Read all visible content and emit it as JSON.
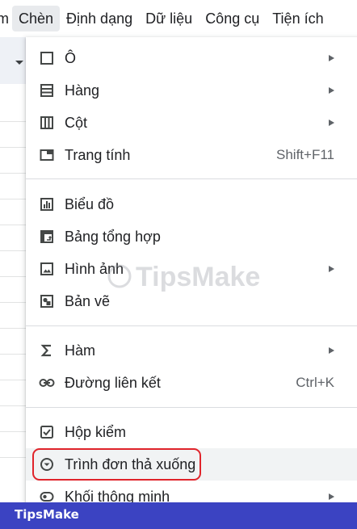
{
  "menubar": {
    "items": [
      {
        "label": "m"
      },
      {
        "label": "Chèn"
      },
      {
        "label": "Định dạng"
      },
      {
        "label": "Dữ liệu"
      },
      {
        "label": "Công cụ"
      },
      {
        "label": "Tiện ích"
      }
    ]
  },
  "menu": {
    "items": [
      {
        "label": "Ô",
        "icon": "square-icon"
      },
      {
        "label": "Hàng",
        "icon": "rows-icon"
      },
      {
        "label": "Cột",
        "icon": "columns-icon"
      },
      {
        "label": "Trang tính",
        "icon": "sheet-tab-icon",
        "shortcut": "Shift+F11"
      },
      {
        "label": "Biểu đồ",
        "icon": "chart-icon"
      },
      {
        "label": "Bảng tổng hợp",
        "icon": "pivot-table-icon"
      },
      {
        "label": "Hình ảnh",
        "icon": "image-icon"
      },
      {
        "label": "Bản vẽ",
        "icon": "drawing-icon"
      },
      {
        "label": "Hàm",
        "icon": "sigma-icon"
      },
      {
        "label": "Đường liên kết",
        "icon": "link-icon",
        "shortcut": "Ctrl+K"
      },
      {
        "label": "Hộp kiểm",
        "icon": "checkbox-icon"
      },
      {
        "label": "Trình đơn thả xuống",
        "icon": "dropdown-circle-icon"
      },
      {
        "label": "Khối thông minh",
        "icon": "smart-chip-icon"
      }
    ]
  },
  "watermark": {
    "text": "TipsMake"
  },
  "footer": {
    "brand": "TipsMake"
  },
  "colors": {
    "highlight_box": "#e0242b",
    "footer_bg": "#3b43c2",
    "active_menu_bg": "#e8eaed"
  }
}
